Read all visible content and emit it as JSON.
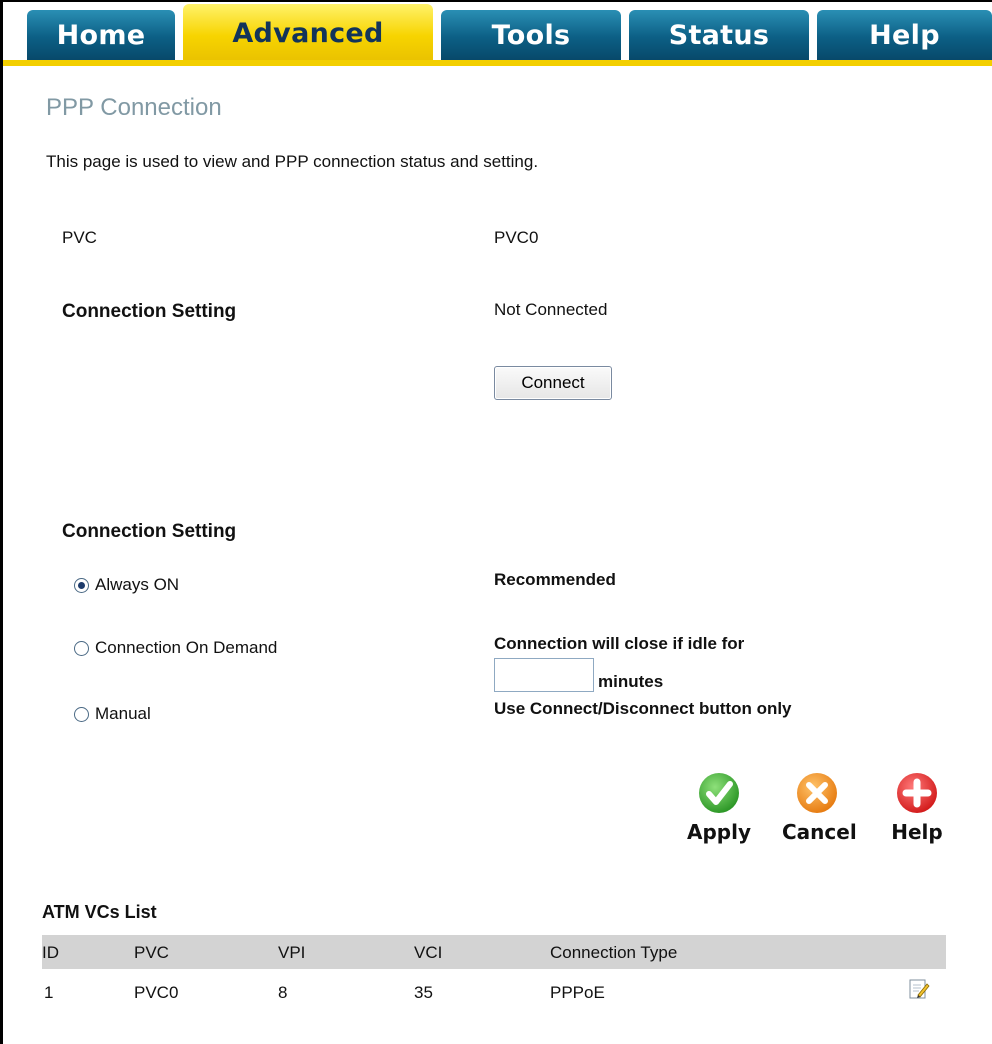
{
  "tabs": [
    {
      "label": "Home",
      "active": false
    },
    {
      "label": "Advanced",
      "active": true
    },
    {
      "label": "Tools",
      "active": false
    },
    {
      "label": "Status",
      "active": false
    },
    {
      "label": "Help",
      "active": false
    }
  ],
  "page": {
    "title": "PPP Connection",
    "description": "This page is used to view and PPP connection status and setting."
  },
  "pvc": {
    "label": "PVC",
    "value": "PVC0"
  },
  "status_section": {
    "heading": "Connection Setting",
    "status": "Not Connected",
    "connect_button": "Connect"
  },
  "setting_section": {
    "heading": "Connection Setting",
    "options": [
      {
        "label": "Always ON",
        "selected": true
      },
      {
        "label": "Connection On Demand",
        "selected": false
      },
      {
        "label": "Manual",
        "selected": false
      }
    ],
    "recommended": "Recommended",
    "idle_text": "Connection will close if idle for",
    "idle_value": "",
    "minutes": "minutes",
    "manual_note": "Use Connect/Disconnect button only"
  },
  "actions": {
    "apply": "Apply",
    "cancel": "Cancel",
    "help": "Help"
  },
  "atm_list": {
    "title": "ATM VCs List",
    "columns": [
      "ID",
      "PVC",
      "VPI",
      "VCI",
      "Connection Type"
    ],
    "rows": [
      {
        "id": "1",
        "pvc": "PVC0",
        "vpi": "8",
        "vci": "35",
        "type": "PPPoE"
      }
    ]
  },
  "colors": {
    "tab_blue": "#0c5f85",
    "tab_active_yellow": "#f7d400",
    "title_gray": "#8199a4",
    "apply_green": "#3aa52e",
    "cancel_orange": "#f08a1c",
    "help_red": "#e02020"
  },
  "icons": {
    "apply": "checkmark-icon",
    "cancel": "x-icon",
    "help": "plus-icon",
    "edit": "edit-icon"
  }
}
